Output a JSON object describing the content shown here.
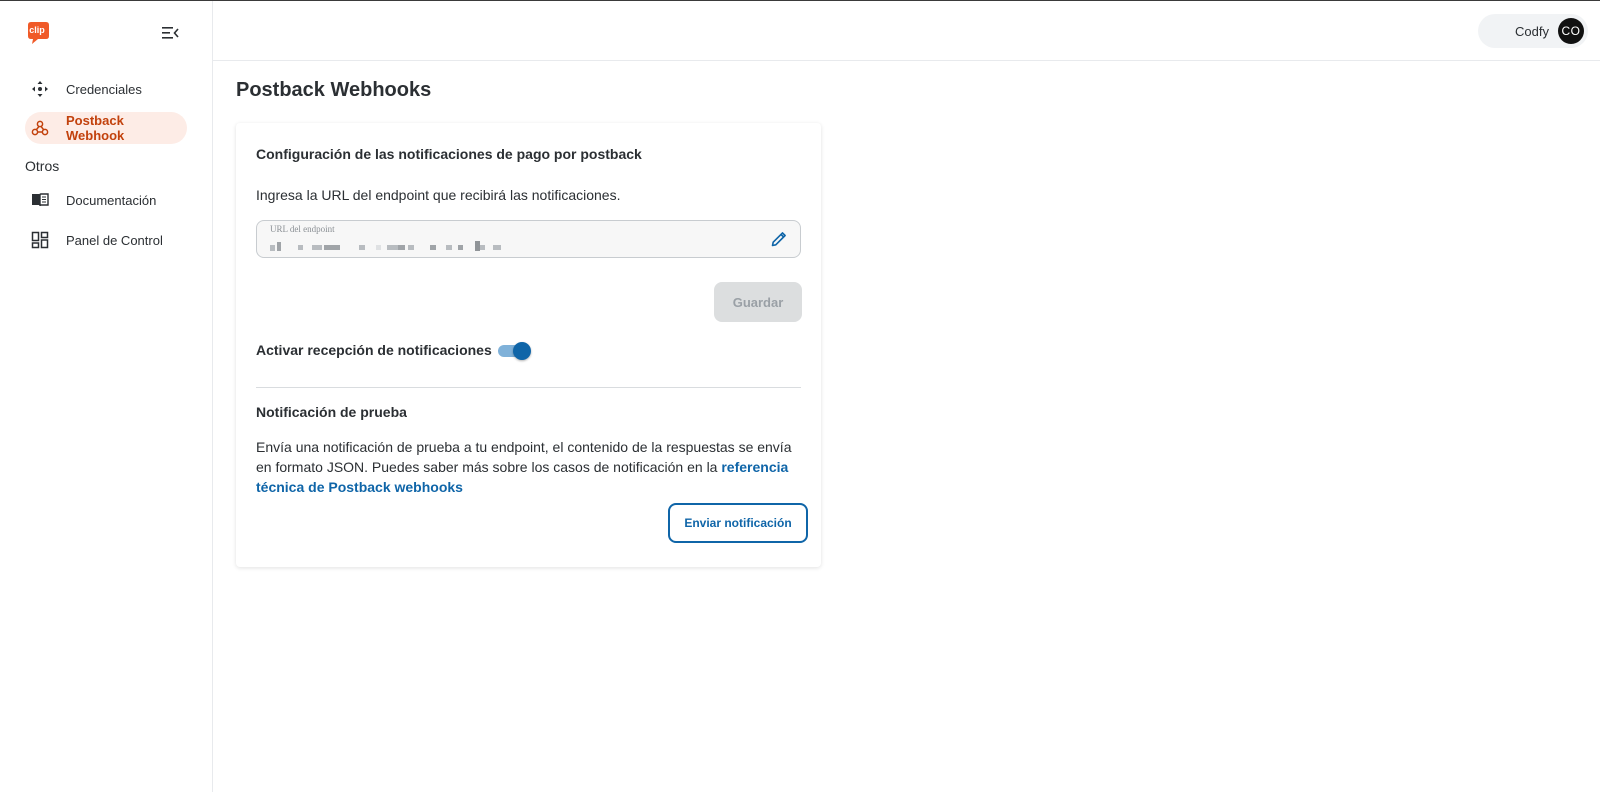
{
  "brand": {
    "logo_text": "clip",
    "accent": "#f05a28"
  },
  "sidebar": {
    "items": [
      {
        "label": "Credenciales",
        "icon": "move-arrows-icon"
      },
      {
        "label": "Postback Webhook",
        "icon": "webhook-icon",
        "active": true
      }
    ],
    "section_label": "Otros",
    "other_items": [
      {
        "label": "Documentación",
        "icon": "book-icon"
      },
      {
        "label": "Panel de Control",
        "icon": "dashboard-icon"
      }
    ]
  },
  "header": {
    "user_name": "Codfy",
    "avatar_initials": "CO"
  },
  "main": {
    "title": "Postback Webhooks",
    "card": {
      "title": "Configuración de las notificaciones de pago por postback",
      "description": "Ingresa la URL del endpoint que recibirá las notificaciones.",
      "url_field_label": "URL del endpoint",
      "save_label": "Guardar",
      "toggle_label": "Activar recepción de notificaciones",
      "toggle_on": true,
      "test_title": "Notificación de prueba",
      "test_desc_text": "Envía una notificación de prueba a tu endpoint, el contenido de la respuestas se envía en formato JSON. Puedes saber más sobre los casos de notificación en la ",
      "test_desc_link": "referencia técnica de Postback webhooks",
      "send_label": "Enviar notificación"
    }
  },
  "colors": {
    "primary": "#0f65a8",
    "active_nav_bg": "#fdece6",
    "active_nav_text": "#c2410c"
  }
}
